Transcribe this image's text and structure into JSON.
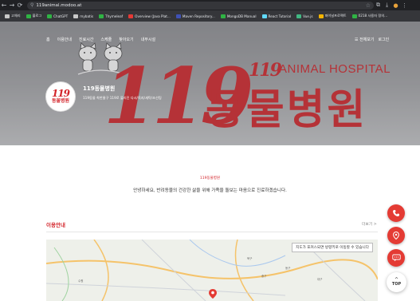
{
  "browser": {
    "nav_icons": [
      "←",
      "→",
      "⟳"
    ],
    "url": "119animal.modoo.at",
    "toolbar_icons": [
      "☆",
      "⧉",
      "⤓",
      "●",
      "⋮"
    ],
    "bookmarks": [
      {
        "label": "고체리",
        "color": "#c8c8c8"
      },
      {
        "label": "블로그",
        "color": "#2fb344"
      },
      {
        "label": "ChatGPT",
        "color": "#2fb344"
      },
      {
        "label": "mybatis",
        "color": "#c8c8c8"
      },
      {
        "label": "Thymeleaf",
        "color": "#2fb344"
      },
      {
        "label": "Overview (Java Plat...",
        "color": "#e53935"
      },
      {
        "label": "Maven Repository...",
        "color": "#3f51b5"
      },
      {
        "label": "MongoDB Manual",
        "color": "#2fb344"
      },
      {
        "label": "React Tutorial",
        "color": "#61dafb"
      },
      {
        "label": "Vue.js",
        "color": "#41b883"
      },
      {
        "label": "파이널프로젝트",
        "color": "#f4b400"
      },
      {
        "label": "0218 사용자 정의...",
        "color": "#2fb344"
      }
    ]
  },
  "hero": {
    "nav": [
      "홈",
      "이용안내",
      "진료시간",
      "스케줄",
      "찾아오기",
      "내부시설"
    ],
    "top_right": [
      "전체보기",
      "로그인"
    ],
    "big_number": "119",
    "small_number": "119",
    "animal_hospital": "ANIMAL HOSPITAL",
    "korean_title": "동물병원",
    "logo_number": "119",
    "logo_text": "동물병원",
    "hospital_name": "119동물병원",
    "hospital_desc": "119동물 착한줄구 119로 불리진 다시/독지/세탁/조선팅"
  },
  "main": {
    "intro_tag": "119동물병원",
    "intro": "안녕하세요, 반려동물의 건강한 삶을 위해 가족을 돌보는 마음으로 진료하겠습니다.",
    "section_title": "이용안내",
    "section_more": "더보기 >",
    "map_tip": "지도가 포커스되면 방향키로 이동할 수 있습니다",
    "map_labels": [
      "수원",
      "북구",
      "동구",
      "중구",
      "대구"
    ]
  },
  "fabs": {
    "top_label": "TOP",
    "top_arrow": "^",
    "icons": [
      "phone-icon",
      "location-pin-icon",
      "chat-icon"
    ]
  },
  "colors": {
    "brand_red": "#d3242a",
    "fab_red": "#e43b34"
  }
}
